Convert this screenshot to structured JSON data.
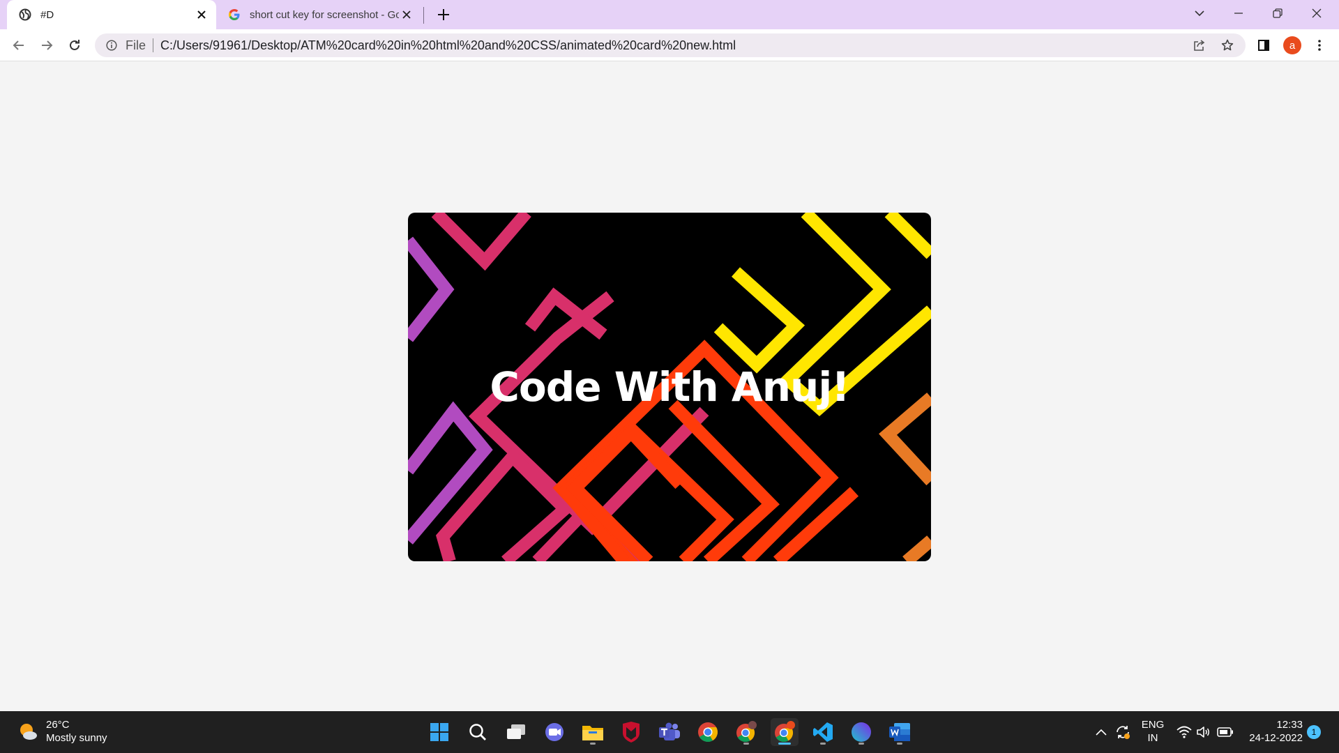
{
  "browser": {
    "tabs": [
      {
        "title": "#D",
        "active": true
      },
      {
        "title": "short cut key for screenshot - Go",
        "active": false
      }
    ],
    "address": {
      "scheme_label": "File",
      "url": "C:/Users/91961/Desktop/ATM%20card%20in%20html%20and%20CSS/animated%20card%20new.html"
    },
    "profile_initial": "a"
  },
  "page": {
    "card_title": "Code With Anuj!",
    "card_colors": {
      "background": "#000000",
      "purple": "#b14bc0",
      "pink": "#d8306a",
      "red": "#ff3b0a",
      "orange": "#e87a25",
      "yellow": "#ffe600"
    }
  },
  "taskbar": {
    "weather": {
      "temp": "26°C",
      "condition": "Mostly sunny"
    },
    "apps": [
      "windows-start",
      "search",
      "task-view",
      "chat",
      "file-explorer",
      "mcafee",
      "teams",
      "chrome",
      "chrome-profile-2",
      "chrome-profile-a",
      "vscode",
      "canva",
      "word"
    ],
    "language": {
      "line1": "ENG",
      "line2": "IN"
    },
    "clock": {
      "time": "12:33",
      "date": "24-12-2022"
    },
    "notification_count": "1"
  }
}
